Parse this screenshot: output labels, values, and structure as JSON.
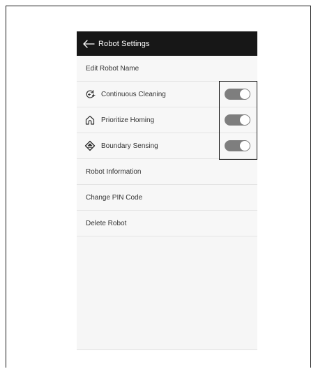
{
  "appbar": {
    "title": "Robot Settings",
    "back_icon": "arrow-left-icon"
  },
  "settings": {
    "edit_name": "Edit Robot Name",
    "continuous_cleaning": {
      "label": "Continuous Cleaning",
      "icon": "refresh-plus-icon",
      "enabled": true
    },
    "prioritize_homing": {
      "label": "Prioritize Homing",
      "icon": "home-icon",
      "enabled": true
    },
    "boundary_sensing": {
      "label": "Boundary Sensing",
      "icon": "boundary-sensor-icon",
      "enabled": true
    },
    "robot_information": "Robot Information",
    "change_pin": "Change PIN Code",
    "delete_robot": "Delete Robot"
  },
  "colors": {
    "appbar_bg": "#171717",
    "toggle_on": "#7e7e7e",
    "list_bg": "#f7f7f7"
  }
}
